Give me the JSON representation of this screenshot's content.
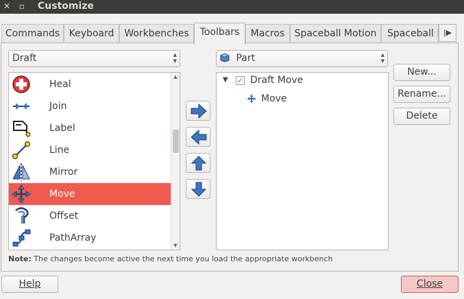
{
  "window": {
    "title": "Customize",
    "close_glyph": "✕",
    "restore_glyph": "▫"
  },
  "tabs": [
    {
      "label": "Commands"
    },
    {
      "label": "Keyboard"
    },
    {
      "label": "Workbenches"
    },
    {
      "label": "Toolbars"
    },
    {
      "label": "Macros"
    },
    {
      "label": "Spaceball Motion"
    },
    {
      "label": "Spaceball B"
    }
  ],
  "tab_scroll_glyph": "|▶",
  "left": {
    "workbench_combo": "Draft",
    "commands": [
      {
        "label": "Heal",
        "icon": "heal-icon"
      },
      {
        "label": "Join",
        "icon": "join-icon"
      },
      {
        "label": "Label",
        "icon": "label-icon"
      },
      {
        "label": "Line",
        "icon": "line-icon"
      },
      {
        "label": "Mirror",
        "icon": "mirror-icon"
      },
      {
        "label": "Move",
        "icon": "move-icon",
        "selected": true
      },
      {
        "label": "Offset",
        "icon": "offset-icon"
      },
      {
        "label": "PathArray",
        "icon": "patharray-icon"
      }
    ]
  },
  "middle": {
    "buttons": [
      "arrow-right-icon",
      "arrow-left-icon",
      "arrow-up-icon",
      "arrow-down-icon"
    ]
  },
  "right": {
    "toolbar_combo": "Part",
    "toolbar_combo_icon": "part-cube-icon",
    "tree": {
      "toolbar_name": "Draft Move",
      "toolbar_checked": true,
      "children": [
        {
          "label": "Move",
          "icon": "move-icon"
        }
      ]
    },
    "buttons": {
      "new": "New...",
      "rename": "Rename...",
      "delete": "Delete"
    }
  },
  "note": {
    "prefix": "Note:",
    "text": "The changes become active the next time you load the appropriate workbench"
  },
  "footer": {
    "help": "Help",
    "close": "Close"
  },
  "colors": {
    "selection": "#f05a4f",
    "close_button_bg": "#f5c8c6",
    "title_bar": "#3b3b37",
    "arrow_blue": "#3b78c2"
  }
}
